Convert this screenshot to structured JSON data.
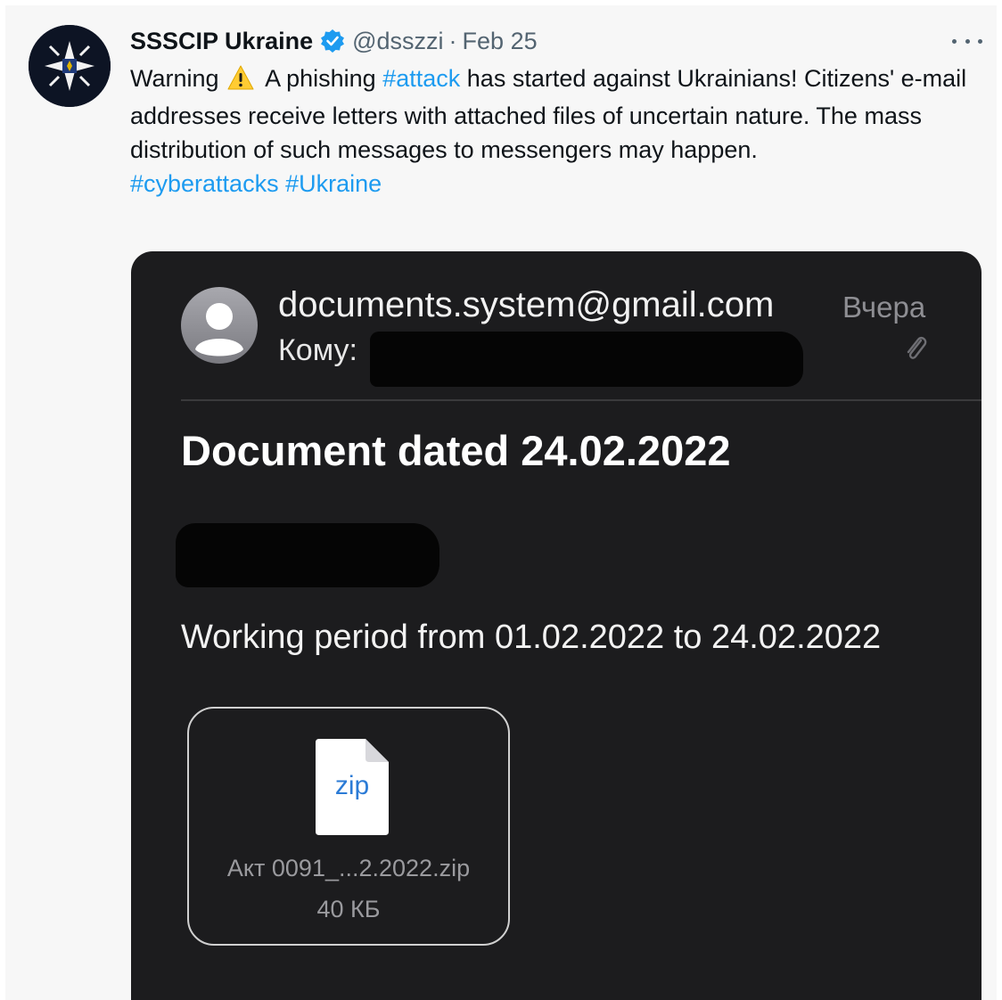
{
  "tweet": {
    "author": "SSSCIP Ukraine",
    "handle": "@dsszzi",
    "separator": "·",
    "date": "Feb 25",
    "text": {
      "warning_word": "Warning",
      "part1": "A phishing",
      "hashtag_attack": "#attack",
      "part2": "has started against Ukrainians! Citizens' e-mail addresses receive letters with attached files of uncertain nature. The mass distribution of such messages to messengers may happen.",
      "hashtag_cyberattacks": "#cyberattacks",
      "hashtag_ukraine": "#Ukraine"
    }
  },
  "email": {
    "from": "documents.system@gmail.com",
    "to_label": "Кому:",
    "date": "Вчера",
    "subject": "Document dated 24.02.2022",
    "body": "Working period from 01.02.2022 to 24.02.2022",
    "attachment": {
      "type_label": "zip",
      "filename": "Акт 0091_...2.2022.zip",
      "size": "40 КБ"
    }
  },
  "icons": {
    "verified": "verified-badge-icon",
    "warning": "warning-sign-icon",
    "more": "more-options-icon",
    "paperclip": "paperclip-icon",
    "file": "file-icon"
  },
  "colors": {
    "link": "#1d9bf0",
    "muted": "#536471",
    "email_bg": "#1c1c1e"
  }
}
